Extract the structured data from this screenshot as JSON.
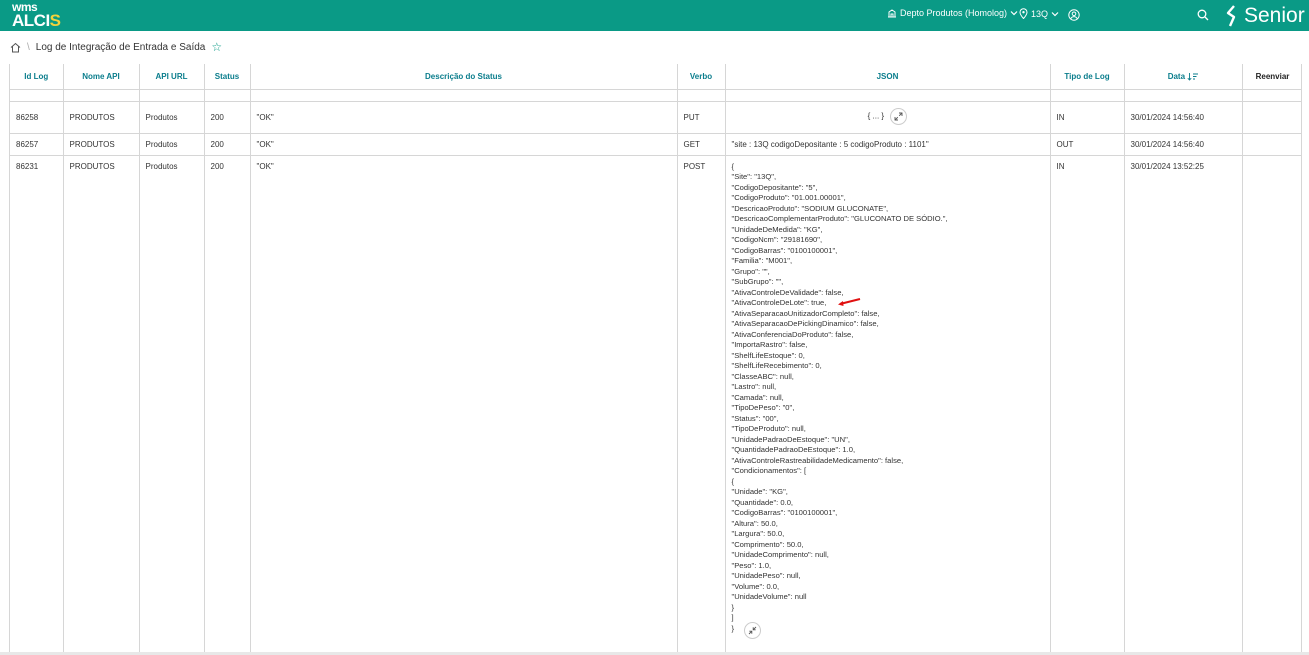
{
  "app": {
    "logo_top": "wms",
    "logo_main": "ALCI",
    "logo_accent": "S",
    "department": "Depto Produtos (Homolog)",
    "site": "13Q",
    "brand": "Senior"
  },
  "page": {
    "title": "Log de Integração de Entrada e Saída"
  },
  "table": {
    "headers": {
      "id": "Id Log",
      "nome_api": "Nome API",
      "api_url": "API URL",
      "status": "Status",
      "descricao": "Descrição do Status",
      "verbo": "Verbo",
      "json": "JSON",
      "tipo": "Tipo de Log",
      "data": "Data",
      "reenviar": "Reenviar"
    },
    "rows": [
      {
        "id": "86258",
        "nome_api": "PRODUTOS",
        "api_url": "Produtos",
        "status": "200",
        "descricao": "\"OK\"",
        "verbo": "PUT",
        "json": "{ ... }",
        "tipo": "IN",
        "data": "30/01/2024 14:56:40"
      },
      {
        "id": "86257",
        "nome_api": "PRODUTOS",
        "api_url": "Produtos",
        "status": "200",
        "descricao": "\"OK\"",
        "verbo": "GET",
        "json": "\"site : 13Q codigoDepositante : 5 codigoProduto : 1101\"",
        "tipo": "OUT",
        "data": "30/01/2024 14:56:40"
      },
      {
        "id": "86231",
        "nome_api": "PRODUTOS",
        "api_url": "Produtos",
        "status": "200",
        "descricao": "\"OK\"",
        "verbo": "POST",
        "tipo": "IN",
        "data": "30/01/2024 13:52:25"
      }
    ],
    "json_expanded": "{\n\"Site\": \"13Q\",\n\"CodigoDepositante\": \"5\",\n\"CodigoProduto\": \"01.001.00001\",\n\"DescricaoProduto\": \"SODIUM GLUCONATE\",\n\"DescricaoComplementarProduto\": \"GLUCONATO DE SÓDIO.\",\n\"UnidadeDeMedida\": \"KG\",\n\"CodigoNcm\": \"29181690\",\n\"CodigoBarras\": \"0100100001\",\n\"Familia\": \"M001\",\n\"Grupo\": \"\",\n\"SubGrupo\": \"\",\n\"AtivaControleDeValidade\": false,\n\"AtivaControleDeLote\": true,\n\"AtivaSeparacaoUnitizadorCompleto\": false,\n\"AtivaSeparacaoDePickingDinamico\": false,\n\"AtivaConferenciaDoProduto\": false,\n\"ImportaRastro\": false,\n\"ShelfLifeEstoque\": 0,\n\"ShelfLifeRecebimento\": 0,\n\"ClasseABC\": null,\n\"Lastro\": null,\n\"Camada\": null,\n\"TipoDePeso\": \"0\",\n\"Status\": \"00\",\n\"TipoDeProduto\": null,\n\"UnidadePadraoDeEstoque\": \"UN\",\n\"QuantidadePadraoDeEstoque\": 1.0,\n\"AtivaControleRastreabilidadeMedicamento\": false,\n\"Condicionamentos\": [\n{\n\"Unidade\": \"KG\",\n\"Quantidade\": 0.0,\n\"CodigoBarras\": \"0100100001\",\n\"Altura\": 50.0,\n\"Largura\": 50.0,\n\"Comprimento\": 50.0,\n\"UnidadeComprimento\": null,\n\"Peso\": 1.0,\n\"UnidadePeso\": null,\n\"Volume\": 0.0,\n\"UnidadeVolume\": null\n}\n]\n}"
  },
  "colors": {
    "topbar": "#0a9a86",
    "header_text": "#0a7d8c",
    "annotation_arrow": "#e01010"
  }
}
